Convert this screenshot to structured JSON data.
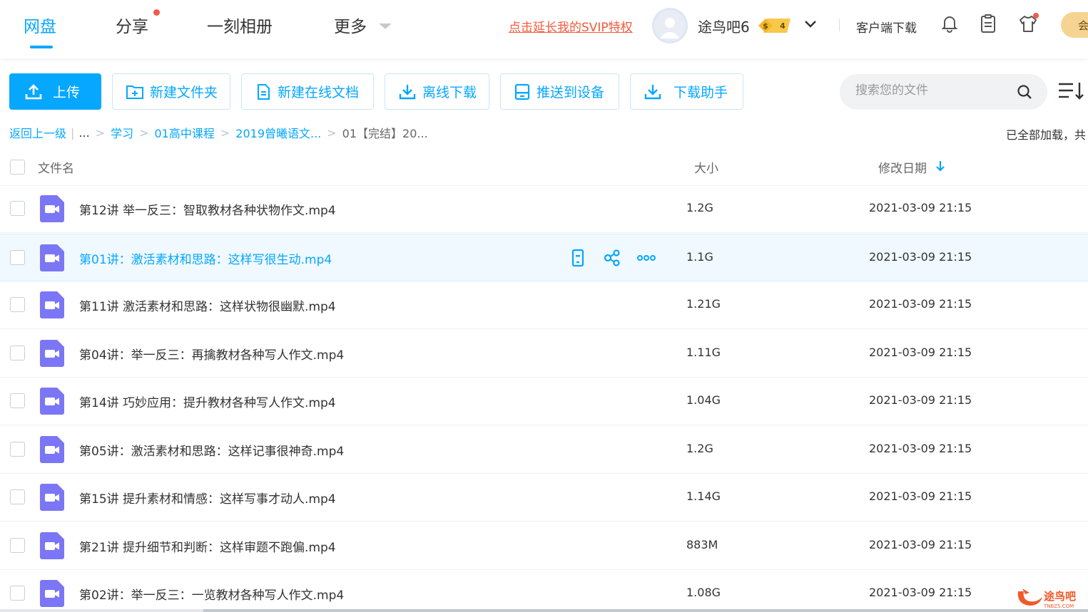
{
  "nav": {
    "tabs": [
      {
        "label": "网盘",
        "active": true
      },
      {
        "label": "分享",
        "badge": true
      },
      {
        "label": "一刻相册"
      },
      {
        "label": "更多"
      }
    ],
    "svip_link": "点击延长我的SVIP特权",
    "user": {
      "name": "途鸟吧6",
      "vip_level": "4"
    },
    "client_download": "客户端下载",
    "vip_pill": "会"
  },
  "toolbar": {
    "upload": "上传",
    "new_folder": "新建文件夹",
    "new_doc": "新建在线文档",
    "offline_download": "离线下载",
    "push_device": "推送到设备",
    "download_helper": "下载助手",
    "search_placeholder": "搜索您的文件"
  },
  "breadcrumb": {
    "back": "返回上一级",
    "ellipsis": "...",
    "items": [
      "学习",
      "01高中课程",
      "2019曾曦语文..."
    ],
    "current": "01【完结】20...",
    "loaded_note": "已全部加载，共"
  },
  "table": {
    "headers": {
      "name": "文件名",
      "size": "大小",
      "date": "修改日期"
    },
    "rows": [
      {
        "name": "第12讲 举一反三：智取教材各种状物作文.mp4",
        "size": "1.2G",
        "date": "2021-03-09 21:15"
      },
      {
        "name": "第01讲：激活素材和思路：这样写很生动.mp4",
        "size": "1.1G",
        "date": "2021-03-09 21:15",
        "hover": true
      },
      {
        "name": "第11讲 激活素材和思路：这样状物很幽默.mp4",
        "size": "1.21G",
        "date": "2021-03-09 21:15"
      },
      {
        "name": "第04讲：举一反三：再擒教材各种写人作文.mp4",
        "size": "1.11G",
        "date": "2021-03-09 21:15"
      },
      {
        "name": "第14讲 巧妙应用：提升教材各种写人作文.mp4",
        "size": "1.04G",
        "date": "2021-03-09 21:15"
      },
      {
        "name": "第05讲：激活素材和思路：这样记事很神奇.mp4",
        "size": "1.2G",
        "date": "2021-03-09 21:15"
      },
      {
        "name": "第15讲 提升素材和情感：这样写事才动人.mp4",
        "size": "1.14G",
        "date": "2021-03-09 21:15"
      },
      {
        "name": "第21讲 提升细节和判断：这样审题不跑偏.mp4",
        "size": "883M",
        "date": "2021-03-09 21:15"
      },
      {
        "name": "第02讲：举一反三：一览教材各种写人作文.mp4",
        "size": "1.08G",
        "date": "2021-03-09 21:15"
      }
    ]
  },
  "watermark": {
    "text": "途鸟吧",
    "sub": "TNBZS.COM"
  },
  "colors": {
    "accent": "#06a7ff",
    "video_icon": "#7b76f5",
    "svip_red": "#f25a3d",
    "hover_row": "#f0f9ff"
  }
}
